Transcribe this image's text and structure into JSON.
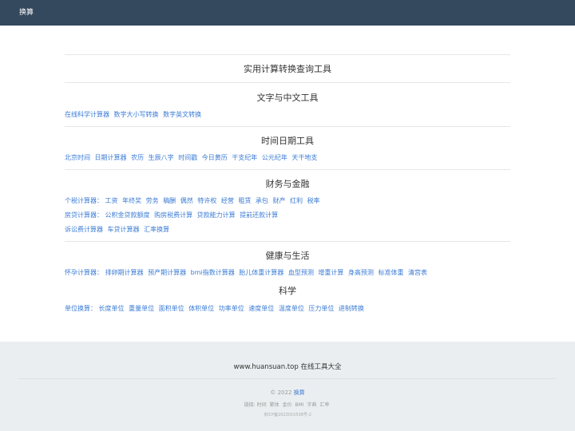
{
  "header": {
    "brand": "换算"
  },
  "main": {
    "title": "实用计算转换查询工具",
    "sections": [
      {
        "title": "文字与中文工具",
        "rows": [
          {
            "label": "",
            "links": [
              "在线科学计算器",
              "数字大小写转换",
              "数字英文转换"
            ]
          }
        ]
      },
      {
        "title": "时间日期工具",
        "rows": [
          {
            "label": "",
            "links": [
              "北京时间",
              "日期计算器",
              "农历",
              "生辰八字",
              "时间戳",
              "今日黄历",
              "干支纪年",
              "公元纪年",
              "天干地支"
            ]
          }
        ]
      },
      {
        "title": "财务与金融",
        "rows": [
          {
            "label": "个税计算器：",
            "links": [
              "工资",
              "年终奖",
              "劳务",
              "稿酬",
              "偶然",
              "特许权",
              "经营",
              "租赁",
              "承包",
              "财产",
              "红利",
              "税率"
            ]
          },
          {
            "label": "房贷计算器：",
            "links": [
              "公积金贷款额度",
              "购房税费计算",
              "贷款能力计算",
              "提前还款计算"
            ]
          },
          {
            "label": "",
            "links": [
              "诉讼费计算器",
              "车贷计算器",
              "汇率换算"
            ]
          }
        ]
      },
      {
        "title": "健康与生活",
        "rows": [
          {
            "label": "怀孕计算器：",
            "links": [
              "排卵期计算器",
              "预产期计算器",
              "bmi指数计算器",
              "胎儿体重计算器",
              "血型预测",
              "增重计算",
              "身高预测",
              "标准体重",
              "清宫表"
            ]
          }
        ]
      },
      {
        "title": "科学",
        "rows": [
          {
            "label": "单位换算：",
            "links": [
              "长度单位",
              "重量单位",
              "面积单位",
              "体积单位",
              "功率单位",
              "速度单位",
              "温度单位",
              "压力单位",
              "进制转换"
            ]
          }
        ]
      }
    ]
  },
  "footer": {
    "title": "www.huansuan.top 在线工具大全",
    "copyright_prefix": "© 2022",
    "copyright_link": "换算",
    "links_label": "链接:",
    "links": [
      "时间",
      "繁体",
      "金价",
      "BMI",
      "字典",
      "汇率"
    ],
    "icp": "京ICP备2023015538号-2"
  }
}
